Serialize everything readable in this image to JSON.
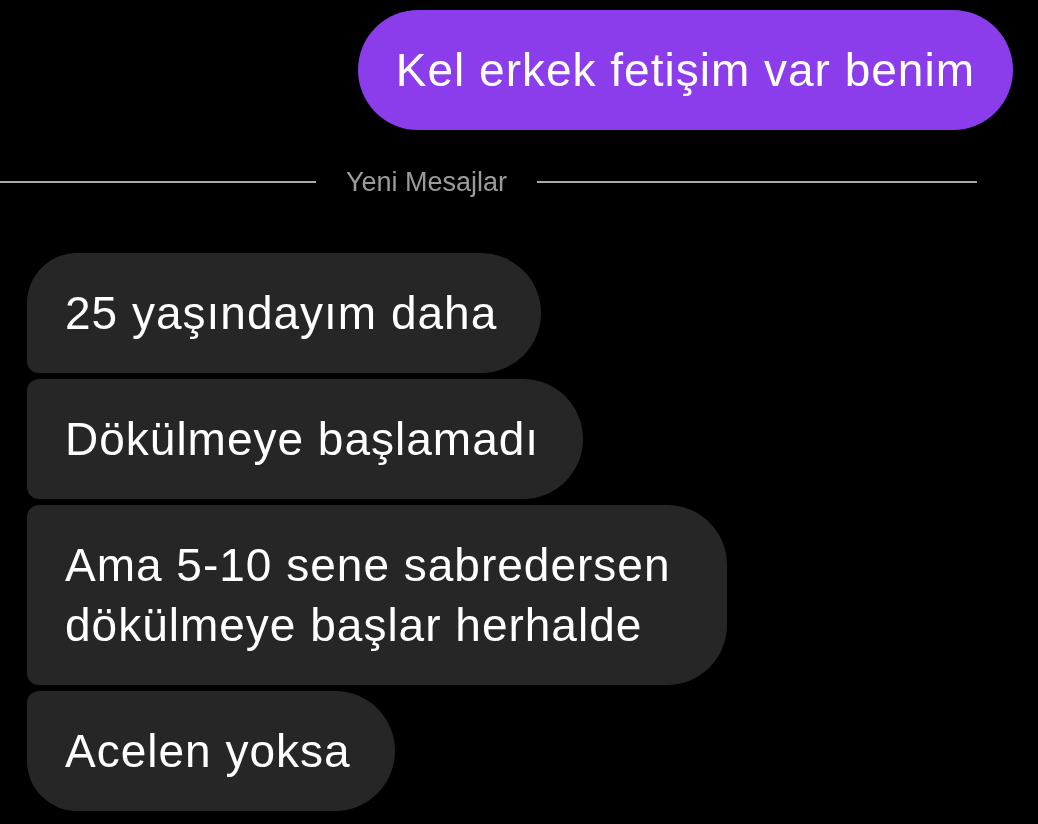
{
  "thread": [
    {
      "kind": "outgoing",
      "text": "Kel erkek fetişim var benim"
    },
    {
      "kind": "divider",
      "text": "Yeni Mesajlar"
    },
    {
      "kind": "incoming",
      "text": "25 yaşındayım daha"
    },
    {
      "kind": "incoming",
      "text": "Dökülmeye başlamadı"
    },
    {
      "kind": "incoming",
      "text": "Ama 5-10 sene sabredersen dökülmeye başlar herhalde"
    },
    {
      "kind": "incoming",
      "text": "Acelen yoksa"
    }
  ]
}
